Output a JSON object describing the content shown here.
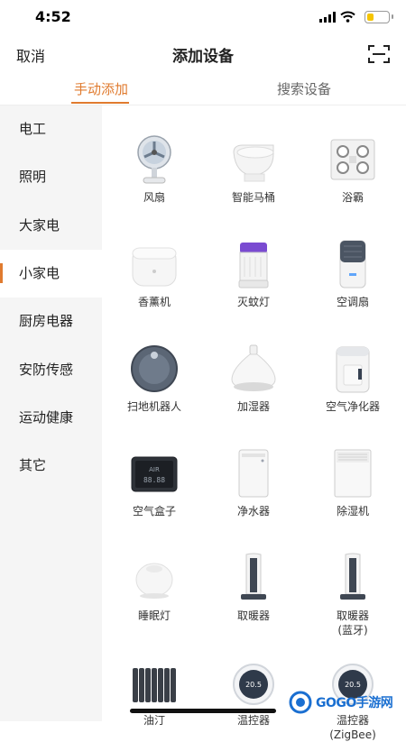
{
  "status": {
    "time": "4:52"
  },
  "nav": {
    "cancel": "取消",
    "title": "添加设备"
  },
  "tabs": [
    {
      "label": "手动添加"
    },
    {
      "label": "搜索设备"
    }
  ],
  "sidebar": {
    "items": [
      {
        "label": "电工"
      },
      {
        "label": "照明"
      },
      {
        "label": "大家电"
      },
      {
        "label": "小家电"
      },
      {
        "label": "厨房电器"
      },
      {
        "label": "安防传感"
      },
      {
        "label": "运动健康"
      },
      {
        "label": "其它"
      }
    ],
    "active": "小家电"
  },
  "devices": [
    {
      "label": "风扇",
      "icon": "fan-icon"
    },
    {
      "label": "智能马桶",
      "icon": "toilet-icon"
    },
    {
      "label": "浴霸",
      "icon": "bath-heater-icon"
    },
    {
      "label": "香薰机",
      "icon": "aroma-diffuser-icon"
    },
    {
      "label": "灭蚊灯",
      "icon": "mosquito-lamp-icon"
    },
    {
      "label": "空调扇",
      "icon": "air-cooler-icon"
    },
    {
      "label": "扫地机器人",
      "icon": "robot-vacuum-icon"
    },
    {
      "label": "加湿器",
      "icon": "humidifier-icon"
    },
    {
      "label": "空气净化器",
      "icon": "air-purifier-icon"
    },
    {
      "label": "空气盒子",
      "icon": "air-box-icon",
      "screen_text": "AIR",
      "screen_digits": "88.88"
    },
    {
      "label": "净水器",
      "icon": "water-purifier-icon"
    },
    {
      "label": "除湿机",
      "icon": "dehumidifier-icon"
    },
    {
      "label": "睡眠灯",
      "icon": "sleep-lamp-icon"
    },
    {
      "label": "取暖器",
      "icon": "heater-icon"
    },
    {
      "label": "取暖器",
      "label2": "(蓝牙)",
      "icon": "heater-bluetooth-icon"
    },
    {
      "label": "油汀",
      "icon": "oil-heater-icon"
    },
    {
      "label": "温控器",
      "icon": "thermostat-icon",
      "display": "20.5"
    },
    {
      "label": "温控器",
      "label2": "(ZigBee)",
      "icon": "thermostat-zigbee-icon",
      "display": "20.5"
    }
  ],
  "watermark": {
    "text": "GOGO手游网"
  },
  "colors": {
    "accent": "#e07b2f",
    "sidebar_bg": "#f5f5f5"
  }
}
